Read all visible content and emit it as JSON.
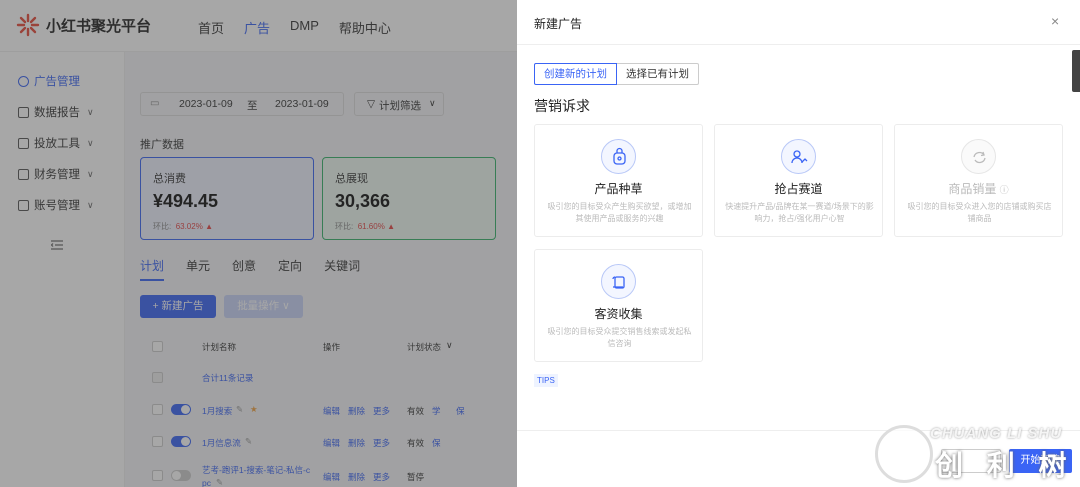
{
  "app": {
    "name": "小红书聚光平台"
  },
  "nav": [
    "首页",
    "广告",
    "DMP",
    "帮助中心"
  ],
  "sidebar": [
    {
      "label": "广告管理",
      "chevron": ""
    },
    {
      "label": "数据报告",
      "chevron": "∨"
    },
    {
      "label": "投放工具",
      "chevron": "∨"
    },
    {
      "label": "财务管理",
      "chevron": "∨"
    },
    {
      "label": "账号管理",
      "chevron": "∨"
    }
  ],
  "filters": {
    "start_date": "2023-01-09",
    "to": "至",
    "end_date": "2023-01-09",
    "plan_filter": "计划筛选"
  },
  "section_title": "推广数据",
  "cards": [
    {
      "title": "总消费",
      "value": "¥494.45",
      "ratio_label": "环比:",
      "ratio": "63.02%"
    },
    {
      "title": "总展现",
      "value": "30,366",
      "ratio_label": "环比:",
      "ratio": "61.60%"
    }
  ],
  "tabs": [
    "计划",
    "单元",
    "创意",
    "定向",
    "关键词"
  ],
  "buttons": {
    "new_ad": "+ 新建广告",
    "batch": "批量操作 ∨"
  },
  "table": {
    "headers": {
      "name": "计划名称",
      "ops": "操作",
      "status": "计划状态"
    },
    "total": "合计11条记录",
    "rows": [
      {
        "name": "1月搜索",
        "edit": "编辑",
        "del": "删除",
        "more": "更多",
        "status": "有效",
        "tag1": "学",
        "tag2": "保",
        "on": true
      },
      {
        "name": "1月信息流",
        "edit": "编辑",
        "del": "删除",
        "more": "更多",
        "status": "有效",
        "tag1": "保",
        "tag2": "",
        "on": true
      },
      {
        "name": "艺考-跑评1-搜索-笔记-私信-c",
        "name2": "pc",
        "edit": "编辑",
        "del": "删除",
        "more": "更多",
        "status": "暂停",
        "tag1": "",
        "tag2": "",
        "on": false
      }
    ]
  },
  "drawer": {
    "title": "新建广告",
    "close": "×",
    "seg_new": "创建新的计划",
    "seg_existing": "选择已有计划",
    "heading": "营销诉求",
    "goals": [
      {
        "name": "产品种草",
        "desc": "吸引您的目标受众产生购买欲望，或增加其使用产品或服务的兴趣"
      },
      {
        "name": "抢占赛道",
        "desc": "快速提升产品/品牌在某一赛道/场景下的影响力，抢占/强化用户心智"
      },
      {
        "name": "商品销量",
        "desc": "吸引您的目标受众进入您的店铺或购买店铺商品",
        "disabled": true
      },
      {
        "name": "客资收集",
        "desc": "吸引您的目标受众提交销售线索或发起私信咨询"
      }
    ],
    "tips": "TIPS",
    "submit": "开始新建"
  },
  "watermark": {
    "top": "CHUANG LI SHU",
    "bottom": "创 利 树"
  }
}
